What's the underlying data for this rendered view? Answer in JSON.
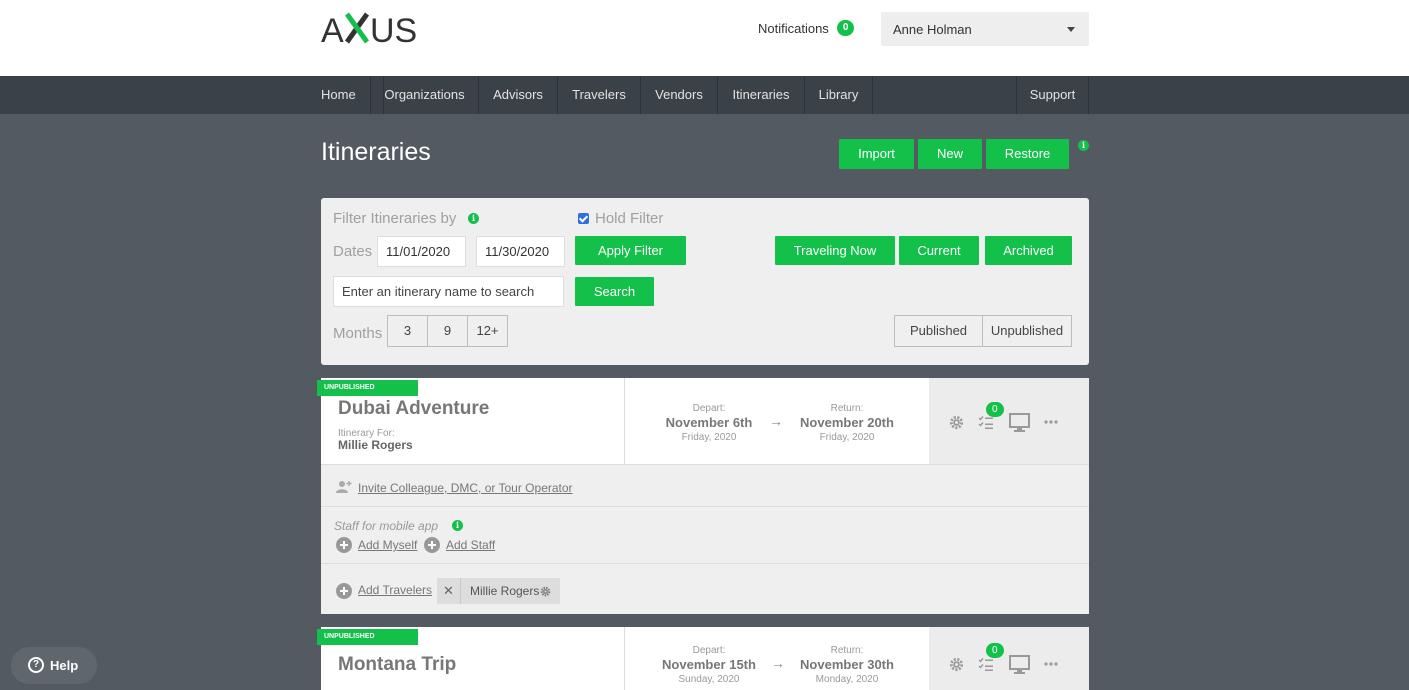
{
  "header": {
    "logo_text": "AXUS",
    "notifications_label": "Notifications",
    "notifications_count": "0",
    "user_name": "Anne Holman"
  },
  "nav": {
    "items": [
      "Home",
      "Organizations",
      "Advisors",
      "Travelers",
      "Vendors",
      "Itineraries",
      "Library"
    ],
    "support": "Support"
  },
  "page": {
    "title": "Itineraries",
    "import_label": "Import",
    "new_label": "New",
    "restore_label": "Restore"
  },
  "filter": {
    "heading": "Filter Itineraries by",
    "hold_filter_label": "Hold Filter",
    "hold_filter_checked": true,
    "dates_label": "Dates",
    "date_from": "11/01/2020",
    "date_to": "11/30/2020",
    "apply_label": "Apply Filter",
    "traveling_now_label": "Traveling Now",
    "current_label": "Current",
    "archived_label": "Archived",
    "search_placeholder": "Enter an itinerary name to search",
    "search_label": "Search",
    "months_label": "Months",
    "months_options": [
      "3",
      "9",
      "12+"
    ],
    "published_label": "Published",
    "unpublished_label": "Unpublished"
  },
  "itineraries": [
    {
      "status": "UNPUBLISHED",
      "title": "Dubai Adventure",
      "for_label": "Itinerary For:",
      "for_name": "Millie Rogers",
      "depart_label": "Depart:",
      "depart_date": "November 6th",
      "depart_day": "Friday, 2020",
      "return_label": "Return:",
      "return_date": "November 20th",
      "return_day": "Friday, 2020",
      "checklist_count": "0",
      "invite_label": "Invite Colleague, DMC, or Tour Operator",
      "staff_label": "Staff for mobile app",
      "add_myself_label": "Add Myself",
      "add_staff_label": "Add Staff",
      "add_travelers_label": "Add Travelers",
      "traveler_chip": "Millie Rogers"
    },
    {
      "status": "UNPUBLISHED",
      "title": "Montana Trip",
      "depart_label": "Depart:",
      "depart_date": "November 15th",
      "depart_day": "Sunday, 2020",
      "return_label": "Return:",
      "return_date": "November 30th",
      "return_day": "Monday, 2020",
      "checklist_count": "0"
    }
  ],
  "help": {
    "label": "Help"
  },
  "colors": {
    "accent": "#13c14a",
    "nav_bg": "#3a4147",
    "page_bg": "#535a61"
  }
}
